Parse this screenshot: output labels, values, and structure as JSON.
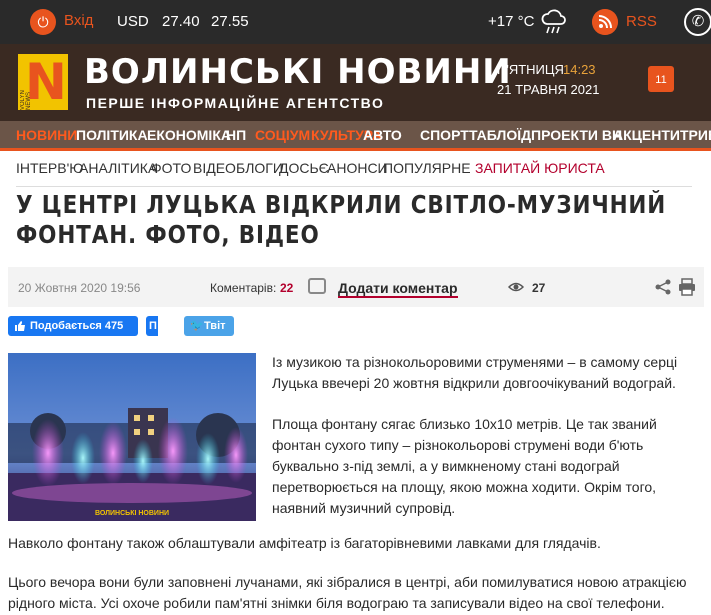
{
  "topbar": {
    "login_label": "Вхід",
    "currency": "USD",
    "buy": "27.40",
    "sell": "27.55",
    "temperature": "+17 °C",
    "rss_label": "RSS",
    "icons": [
      "login-icon",
      "cloud-rain-icon",
      "rss-icon",
      "phone-icon"
    ]
  },
  "header": {
    "site_title": "ВОЛИНСЬКІ НОВИНИ",
    "site_subtitle": "ПЕРШЕ ІНФОРМАЦІЙНЕ АГЕНТСТВО",
    "logo_letter": "N",
    "logo_small": "VOLYN NEWS",
    "day": "П'ЯТНИЦЯ",
    "time": "14:23",
    "date": "21 ТРАВНЯ 2021",
    "calendar_day": "11"
  },
  "main_nav": [
    {
      "label": "НОВИНИ",
      "hot": true
    },
    {
      "label": "ПОЛІТИКА",
      "hot": false
    },
    {
      "label": "ЕКОНОМІКА",
      "hot": false
    },
    {
      "label": "НП",
      "hot": false
    },
    {
      "label": "СОЦІУМ",
      "hot": true
    },
    {
      "label": "КУЛЬТУРА",
      "hot": true
    },
    {
      "label": "АВТО",
      "hot": false
    },
    {
      "label": "СПОРТ",
      "hot": false
    },
    {
      "label": "ТАБЛОЇД",
      "hot": false
    },
    {
      "label": "ПРОЕКТИ ВН",
      "hot": false
    },
    {
      "label": "АКЦЕНТИ",
      "hot": false
    },
    {
      "label": "ТРИБУ",
      "hot": false
    }
  ],
  "sub_nav": [
    "ІНТЕРВ'Ю",
    "АНАЛІТИКА",
    "ФОТО",
    "ВІДЕО",
    "БЛОГИ",
    "ДОСЬЄ",
    "АНОНСИ",
    "ПОПУЛЯРНЕ",
    "ЗАПИТАЙ ЮРИСТА"
  ],
  "article": {
    "headline": "У ЦЕНТРІ ЛУЦЬКА ВІДКРИЛИ СВІТЛО-МУЗИЧНИЙ ФОНТАН. ФОТО, ВІДЕО",
    "datetime": "20 Жовтня 2020 19:56",
    "comments_label": "Коментарів:",
    "comments_count": "22",
    "add_comment": "Додати коментар",
    "views": "27",
    "image_watermark": "ВОЛИНСЬКІ НОВИНИ",
    "paragraphs": [
      "Із музикою та різнокольоровими струменями – в самому серці Луцька ввечері 20 жовтня відкрили довгоочікуваний водограй.",
      "Площа фонтану сягає близько 10х10 метрів. Це так званий фонтан сухого типу – різнокольорові струмені води б'ють буквально з-під землі, а у вимкненому стані водограй перетворюється на площу, якою можна ходити. Окрім того, наявний музичний супровід.",
      "Навколо фонтану також облаштували амфітеатр із багаторівневими лавками для глядачів.",
      "Цього вечора вони були заповнені лучанами, які зібралися в центрі, аби помилуватися новою атракцією рідного міста. Усі охоче робили пам'ятні знімки біля водограю та записували відео на свої телефони."
    ]
  },
  "social": {
    "fb_like": "Подобається 475",
    "fb_share": "П",
    "twitter": "Твіт"
  },
  "colors": {
    "accent": "#e8541e",
    "header_bg": "#3a2a22",
    "nav_bg": "#6b5548",
    "lawyer": "#b3002d"
  }
}
